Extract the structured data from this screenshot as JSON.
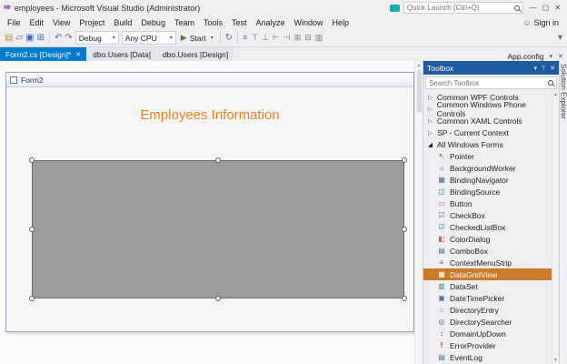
{
  "window": {
    "title": "employees - Microsoft Visual Studio (Administrator)",
    "quick_launch_placeholder": "Quick Launch (Ctrl+Q)"
  },
  "menubar": {
    "items": [
      "File",
      "Edit",
      "View",
      "Project",
      "Build",
      "Debug",
      "Team",
      "Tools",
      "Test",
      "Analyze",
      "Window",
      "Help"
    ],
    "sign_in": "Sign in"
  },
  "toolbar": {
    "debug_target": "Debug",
    "platform": "Any CPU",
    "start_label": "Start"
  },
  "tabs": {
    "documents": [
      {
        "label": "Form2.cs [Design]*"
      },
      {
        "label": "dbo.Users [Data]"
      },
      {
        "label": "dbo.Users [Design]"
      }
    ],
    "right_document": "App.config"
  },
  "designer": {
    "form_title": "Form2",
    "label_text": "Employees Information"
  },
  "toolbox": {
    "title": "Toolbox",
    "search_placeholder": "Search Toolbox",
    "groups": [
      "Common WPF Controls",
      "Common Windows Phone Controls",
      "Common XAML Controls",
      "SP - Current Context",
      "All Windows Forms"
    ],
    "selected_item": "DataGridView",
    "items": [
      {
        "label": "Pointer",
        "glyph": "↖"
      },
      {
        "label": "BackgroundWorker",
        "glyph": "☼"
      },
      {
        "label": "BindingNavigator",
        "glyph": "▦"
      },
      {
        "label": "BindingSource",
        "glyph": "◫"
      },
      {
        "label": "Button",
        "glyph": "▭"
      },
      {
        "label": "CheckBox",
        "glyph": "☑"
      },
      {
        "label": "CheckedListBox",
        "glyph": "☑"
      },
      {
        "label": "ColorDialog",
        "glyph": "◧"
      },
      {
        "label": "ComboBox",
        "glyph": "▤"
      },
      {
        "label": "ContextMenuStrip",
        "glyph": "≡"
      },
      {
        "label": "DataGridView",
        "glyph": "▦"
      },
      {
        "label": "DataSet",
        "glyph": "▥"
      },
      {
        "label": "DateTimePicker",
        "glyph": "▣"
      },
      {
        "label": "DirectoryEntry",
        "glyph": "⌂"
      },
      {
        "label": "DirectorySearcher",
        "glyph": "◎"
      },
      {
        "label": "DomainUpDown",
        "glyph": "↕"
      },
      {
        "label": "ErrorProvider",
        "glyph": "!"
      },
      {
        "label": "EventLog",
        "glyph": "▤"
      }
    ]
  },
  "right_edge_tab": "Solution Explorer",
  "icons": {
    "vs_logo": "∞",
    "caret": "▾",
    "chevron_collapsed": "▷",
    "chevron_expanded": "◢",
    "close": "✕",
    "pin": "⊤",
    "minimize": "—",
    "maximize": "▢",
    "person": "☺",
    "new_project": "▤",
    "open_file": "▱",
    "save": "▣",
    "save_all": "⊞",
    "undo": "↶",
    "redo": "↷",
    "play": "▶",
    "refresh": "↻",
    "align": [
      "≡",
      "⊤",
      "⊥",
      "⊢",
      "⊣",
      "⊞",
      "⊟",
      "▥"
    ],
    "scroll_up": "▲",
    "scroll_down": "▼"
  },
  "colors": {
    "accent": "#007ACC",
    "label_orange": "#F4811F",
    "toolbox_selected": "#C97A2B",
    "toolbox_header": "#1E5B9E"
  }
}
